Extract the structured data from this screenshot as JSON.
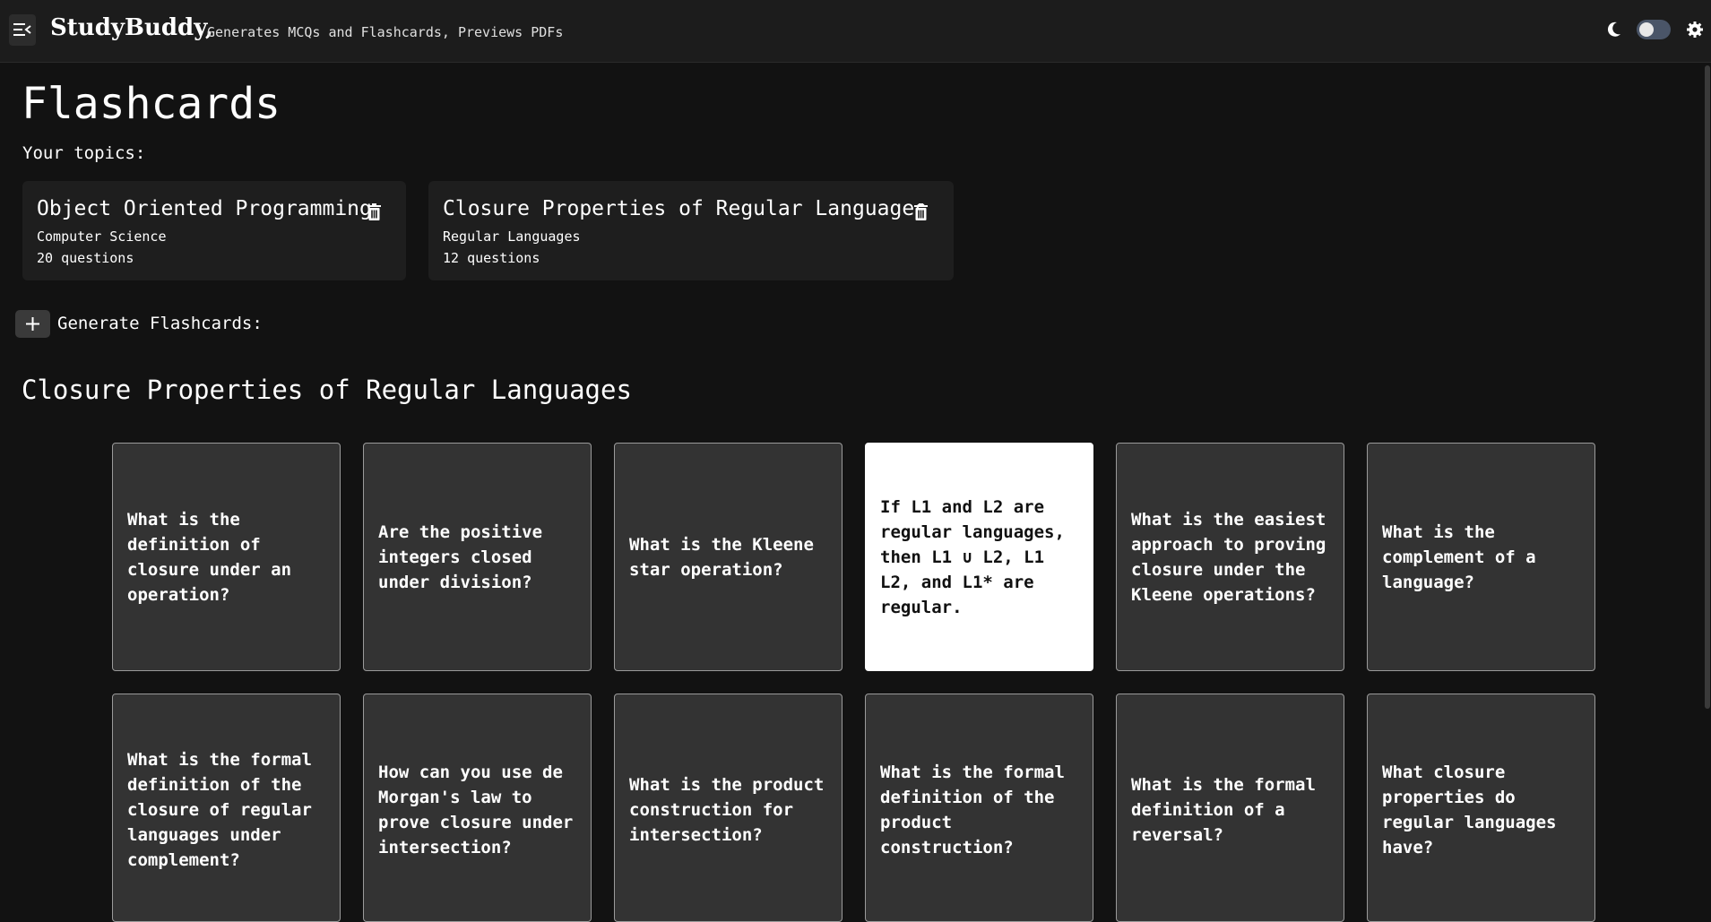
{
  "header": {
    "brand": "StudyBuddy,",
    "tagline": "Generates MCQs and Flashcards, Previews PDFs"
  },
  "page": {
    "title": "Flashcards",
    "topics_label": "Your topics:"
  },
  "topics": [
    {
      "title": "Object Oriented Programming",
      "subject": "Computer Science",
      "count": "20 questions"
    },
    {
      "title": "Closure Properties of Regular Languages",
      "subject": "Regular Languages",
      "count": "12 questions"
    }
  ],
  "generate": {
    "label": "Generate Flashcards:"
  },
  "section": {
    "title": "Closure Properties of Regular Languages"
  },
  "cards": [
    {
      "text": "What is the definition of closure under an operation?"
    },
    {
      "text": "Are the positive integers closed under division?"
    },
    {
      "text": "What is the Kleene star operation?"
    },
    {
      "text": "If L1 and L2 are regular languages, then L1 ∪ L2, L1 L2, and L1* are regular.",
      "flipped": true
    },
    {
      "text": "What is the easiest approach to proving closure under the Kleene operations?"
    },
    {
      "text": "What is the complement of a language?"
    },
    {
      "text": "What is the formal definition of the closure of regular languages under complement?"
    },
    {
      "text": "How can you use de Morgan's law to prove closure under intersection?"
    },
    {
      "text": "What is the product construction for intersection?"
    },
    {
      "text": "What is the formal definition of the product construction?"
    },
    {
      "text": "What is the formal definition of a reversal?"
    },
    {
      "text": "What closure properties do regular languages have?"
    }
  ],
  "theme": {
    "mode": "dark",
    "background": "#121212",
    "card": "#333333",
    "flipped_card": "#ffffff"
  }
}
